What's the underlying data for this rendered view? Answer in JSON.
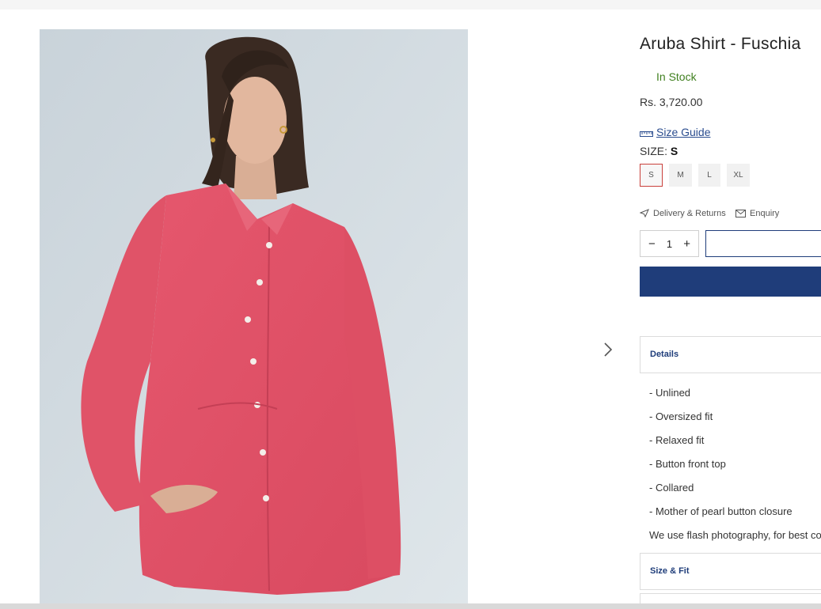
{
  "product": {
    "title": "Aruba Shirt - Fuschia",
    "stock_status": "In Stock",
    "price": "Rs. 3,720.00",
    "size_guide_label": "Size Guide",
    "size_label": "SIZE:",
    "selected_size": "S",
    "sizes": [
      "S",
      "M",
      "L",
      "XL"
    ]
  },
  "actions": {
    "delivery_returns": "Delivery & Returns",
    "enquiry": "Enquiry",
    "qty_minus": "−",
    "quantity": "1",
    "qty_plus": "+"
  },
  "details": {
    "heading": "Details",
    "lines": [
      "- Unlined",
      "- Oversized fit",
      "- Relaxed fit",
      "- Button front top",
      "- Collared",
      "- Mother of pearl button closure",
      "We use flash photography, for best co"
    ]
  },
  "size_fit": {
    "heading": "Size & Fit"
  },
  "colors": {
    "accent": "#1f3d7a",
    "in_stock": "#3f7f1e",
    "selected_border": "#c9403b",
    "shirt": "#e65a6e"
  }
}
